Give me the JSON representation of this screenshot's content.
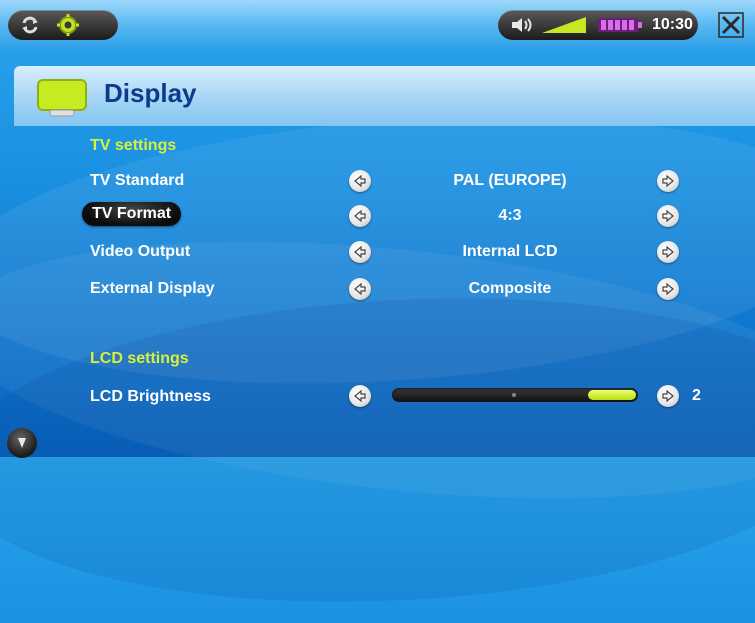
{
  "status_bar": {
    "clock": "10:30",
    "battery_level": 0.8
  },
  "header": {
    "title": "Display"
  },
  "tv_settings": {
    "section_label": "TV settings",
    "rows": [
      {
        "label": "TV Standard",
        "value": "PAL (EUROPE)",
        "selected": false
      },
      {
        "label": "TV Format",
        "value": "4:3",
        "selected": true
      },
      {
        "label": "Video Output",
        "value": "Internal LCD",
        "selected": false
      },
      {
        "label": "External Display",
        "value": "Composite",
        "selected": false
      }
    ]
  },
  "lcd_settings": {
    "section_label": "LCD settings",
    "brightness_label": "LCD Brightness",
    "brightness_value": "2",
    "brightness_fraction": 0.2
  },
  "colors": {
    "section_accent": "#d8f03a",
    "slider_fill": "#c8ec20"
  }
}
